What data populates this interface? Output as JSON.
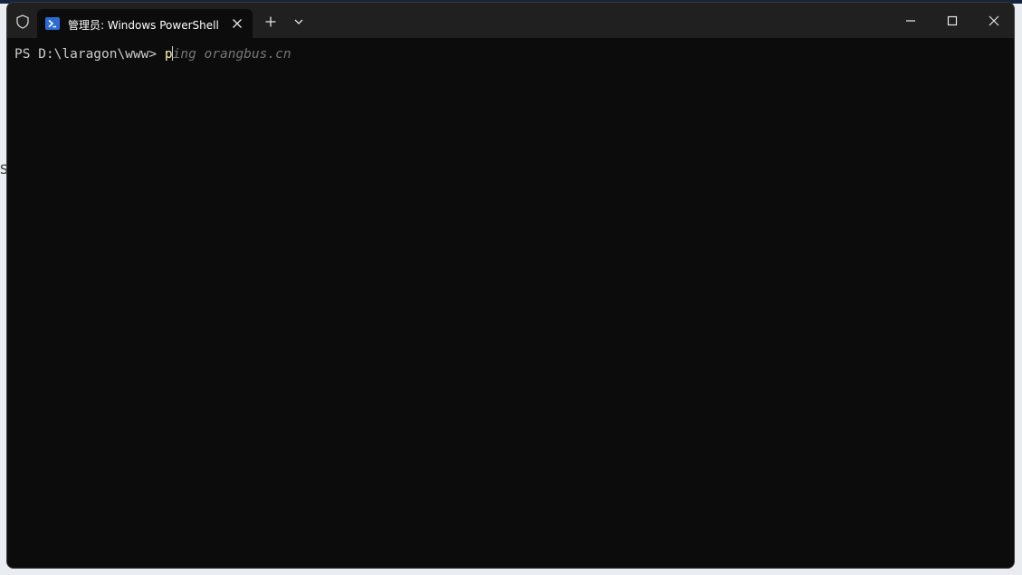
{
  "window": {
    "tab_title": "管理员: Windows PowerShell"
  },
  "icons": {
    "shield": "shield-icon",
    "tab": "powershell-icon",
    "close_tab": "close-icon",
    "new_tab": "plus-icon",
    "dropdown": "chevron-down-icon",
    "minimize": "minimize-icon",
    "maximize": "maximize-icon",
    "close_window": "close-icon"
  },
  "terminal": {
    "prompt": "PS D:\\laragon\\www> ",
    "typed": "p",
    "suggestion": "ing orangbus.cn"
  },
  "colors": {
    "terminal_bg": "#0c0c0c",
    "titlebar_bg": "#202020",
    "text": "#cccccc",
    "typed": "#f9f1a5",
    "suggestion": "#767676"
  }
}
